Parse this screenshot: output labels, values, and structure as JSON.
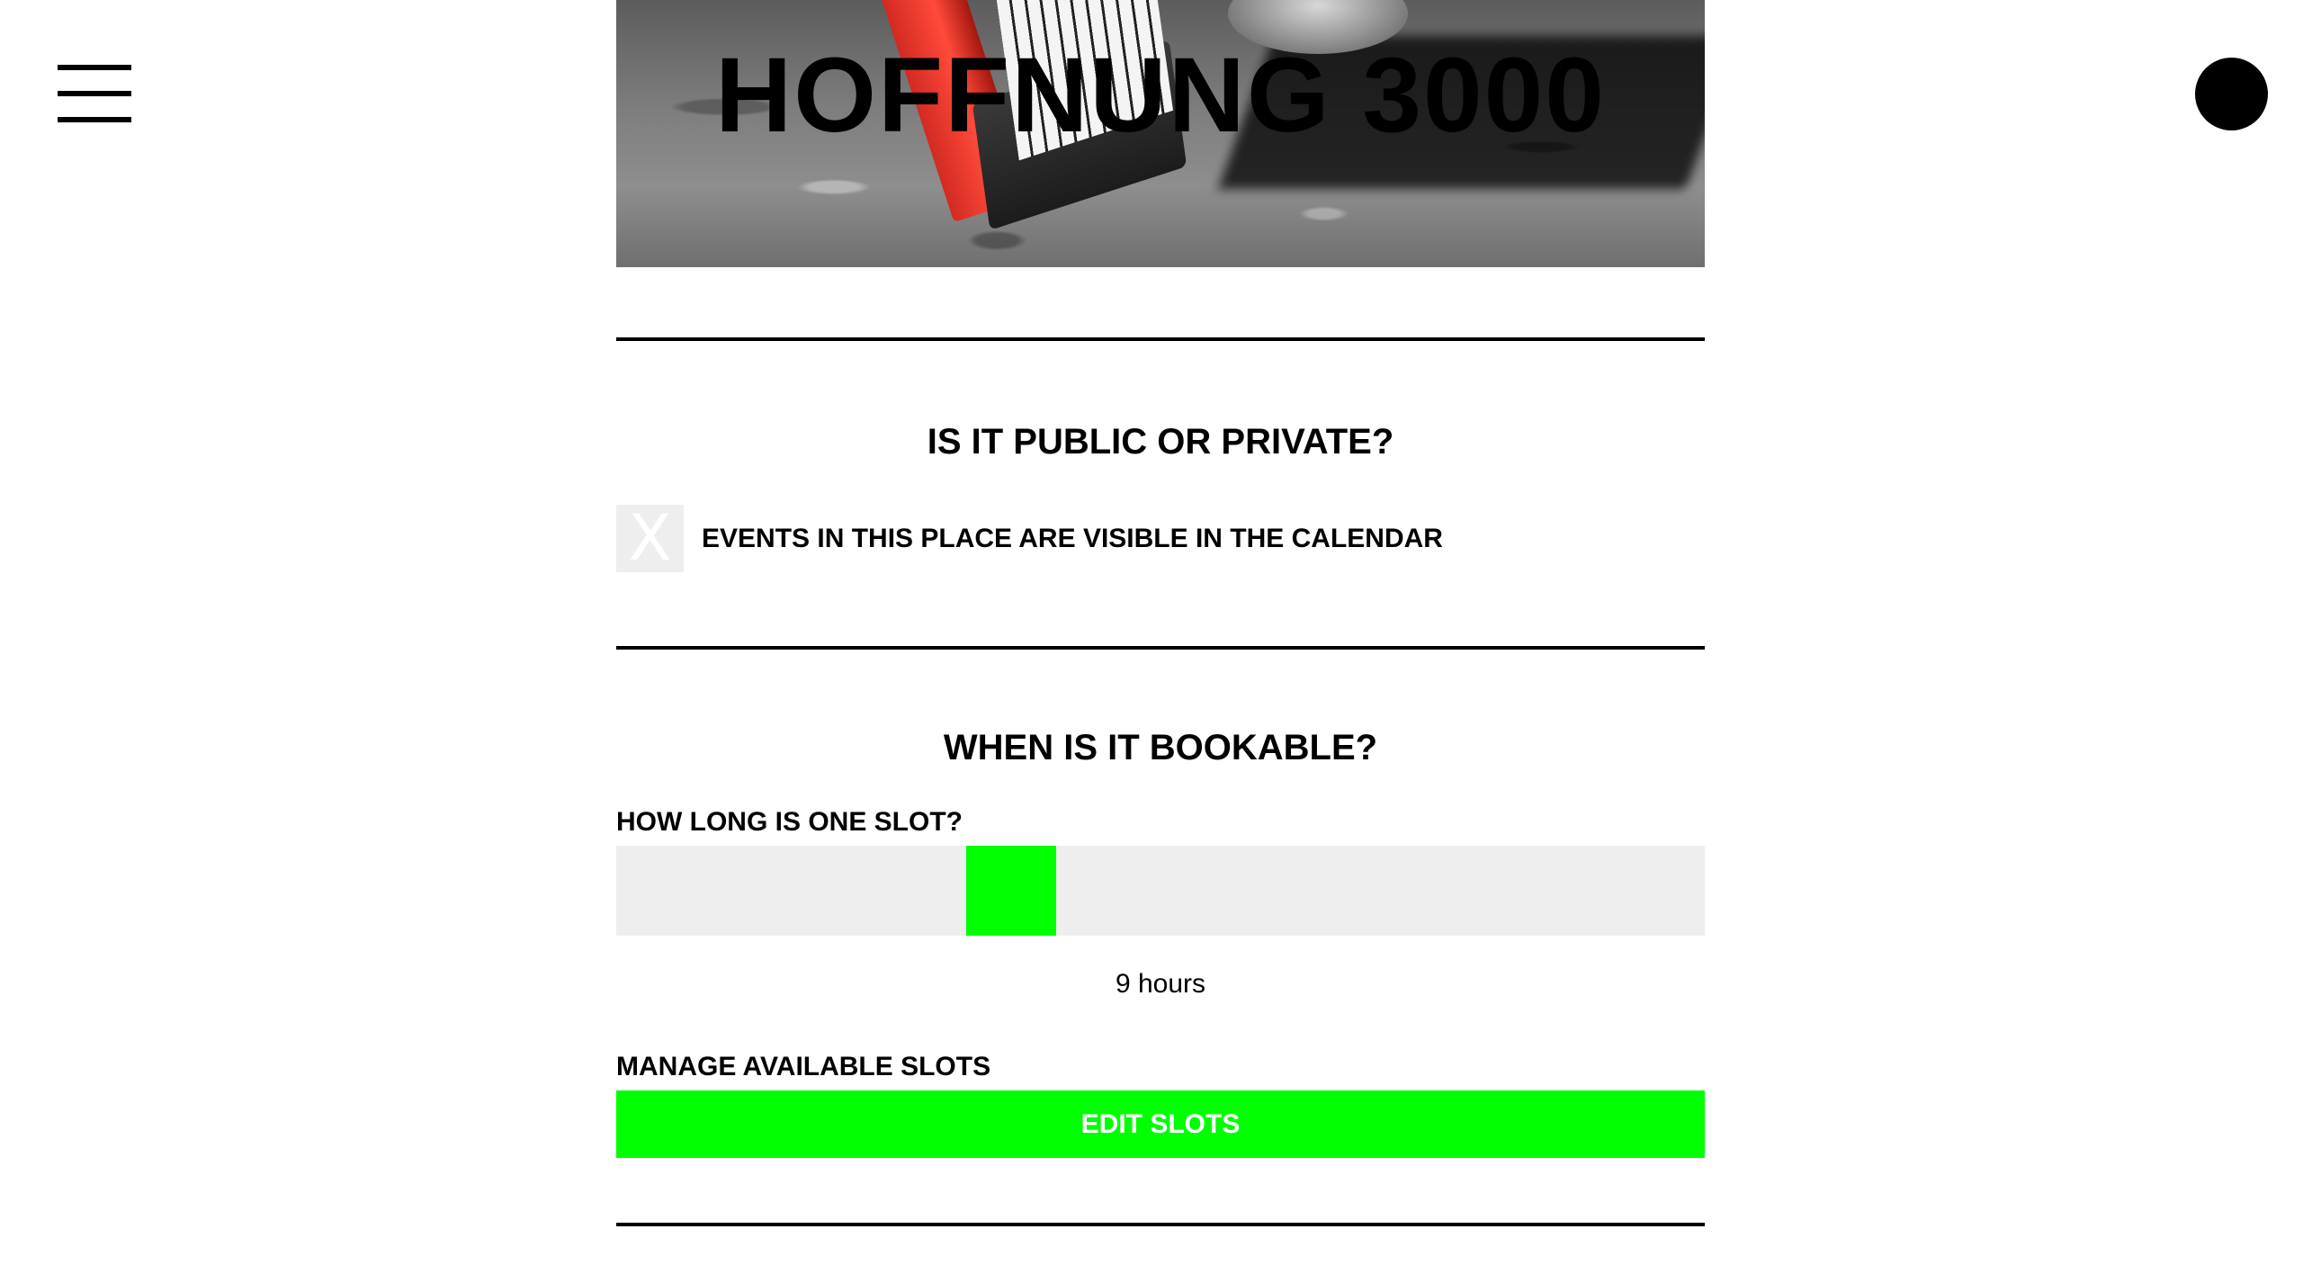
{
  "header": {
    "title": "HOFFNUNG 3000",
    "menu_icon": "hamburger-menu-icon",
    "account_icon": "account-circle-icon"
  },
  "visibility_section": {
    "heading": "IS IT PUBLIC OR PRIVATE?",
    "checkbox_mark": "X",
    "checkbox_label": "EVENTS IN THIS PLACE ARE VISIBLE IN THE CALENDAR"
  },
  "booking_section": {
    "heading": "WHEN IS IT BOOKABLE?",
    "slot_length_label": "HOW LONG IS ONE SLOT?",
    "slot_length_value": "9 hours",
    "slot_slider_fraction": 0.35,
    "manage_label": "MANAGE AVAILABLE SLOTS",
    "edit_button_label": "EDIT SLOTS"
  },
  "colors": {
    "accent": "#00ff00",
    "track": "#eeeeee",
    "text": "#000000"
  }
}
